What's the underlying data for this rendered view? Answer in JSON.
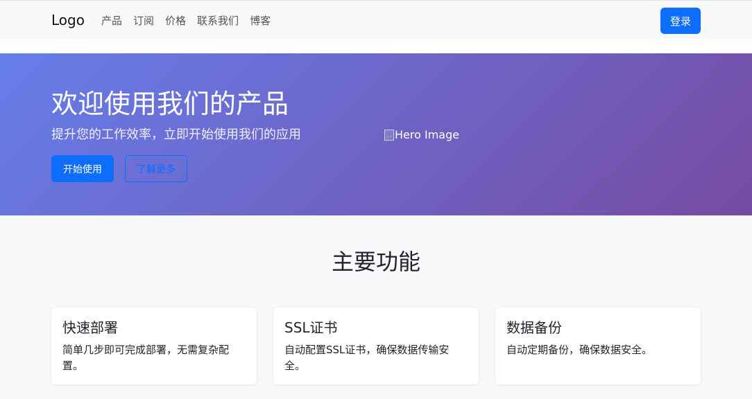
{
  "navbar": {
    "logo": "Logo",
    "links": [
      "产品",
      "订阅",
      "价格",
      "联系我们",
      "博客"
    ],
    "login": "登录"
  },
  "hero": {
    "title": "欢迎使用我们的产品",
    "subtitle": "提升您的工作效率，立即开始使用我们的应用",
    "primary_button": "开始使用",
    "secondary_button": "了解更多",
    "image_alt": "Hero Image"
  },
  "features": {
    "title": "主要功能",
    "cards": [
      {
        "title": "快速部署",
        "text": "简单几步即可完成部署，无需复杂配置。"
      },
      {
        "title": "SSL证书",
        "text": "自动配置SSL证书，确保数据传输安全。"
      },
      {
        "title": "数据备份",
        "text": "自动定期备份，确保数据安全。"
      }
    ]
  },
  "colors": {
    "primary": "#0d6efd",
    "hero_gradient_start": "#667eea",
    "hero_gradient_end": "#764ba2"
  }
}
